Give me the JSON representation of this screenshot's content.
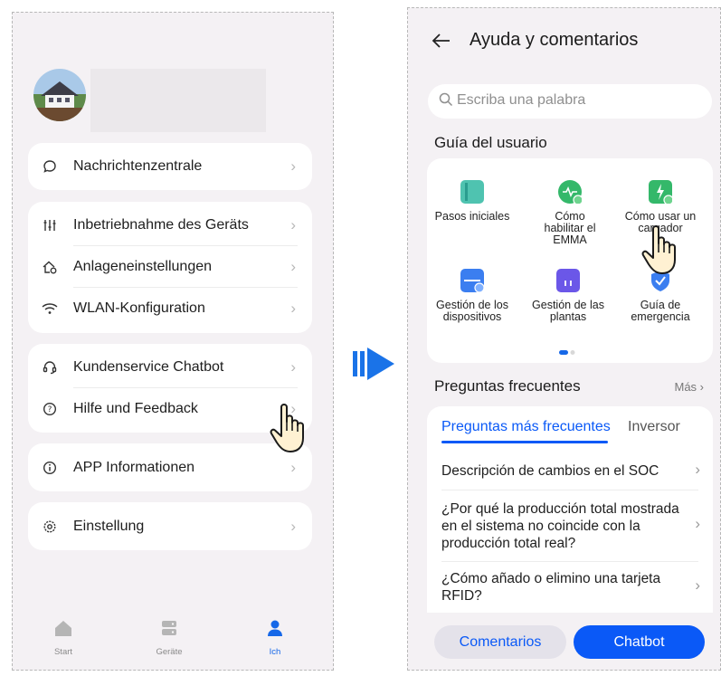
{
  "left": {
    "menu": [
      {
        "label": "Nachrichtenzentrale",
        "icon": "message-icon"
      },
      {
        "label": "Inbetriebnahme des Geräts",
        "icon": "sliders-icon"
      },
      {
        "label": "Anlageneinstellungen",
        "icon": "home-settings-icon"
      },
      {
        "label": "WLAN-Konfiguration",
        "icon": "wifi-icon"
      },
      {
        "label": "Kundenservice Chatbot",
        "icon": "headset-icon"
      },
      {
        "label": "Hilfe und Feedback",
        "icon": "help-icon"
      },
      {
        "label": "APP Informationen",
        "icon": "info-icon"
      },
      {
        "label": "Einstellung",
        "icon": "gear-icon"
      }
    ],
    "tabs": {
      "start": "Start",
      "devices": "Geräte",
      "me": "Ich"
    }
  },
  "right": {
    "title": "Ayuda y comentarios",
    "search_placeholder": "Escriba una palabra",
    "guide_title": "Guía del usuario",
    "guide_items": [
      "Pasos iniciales",
      "Cómo habilitar el EMMA",
      "Cómo usar un cargador",
      "Gestión de los dispositivos",
      "Gestión de las plantas",
      "Guía de emergencia"
    ],
    "faq_title": "Preguntas frecuentes",
    "faq_more": "Más",
    "faq_tabs": [
      "Preguntas más frecuentes",
      "Inversor"
    ],
    "faq_items": [
      "Descripción de cambios en el SOC",
      "¿Por qué la producción total mostrada en el sistema no coincide con la producción total real?",
      "¿Cómo añado o elimino una tarjeta RFID?"
    ],
    "buttons": {
      "feedback": "Comentarios",
      "chatbot": "Chatbot"
    }
  },
  "colors": {
    "accent": "#0a59f7",
    "background": "#f4f1f4",
    "arrow": "#1a73e8"
  }
}
